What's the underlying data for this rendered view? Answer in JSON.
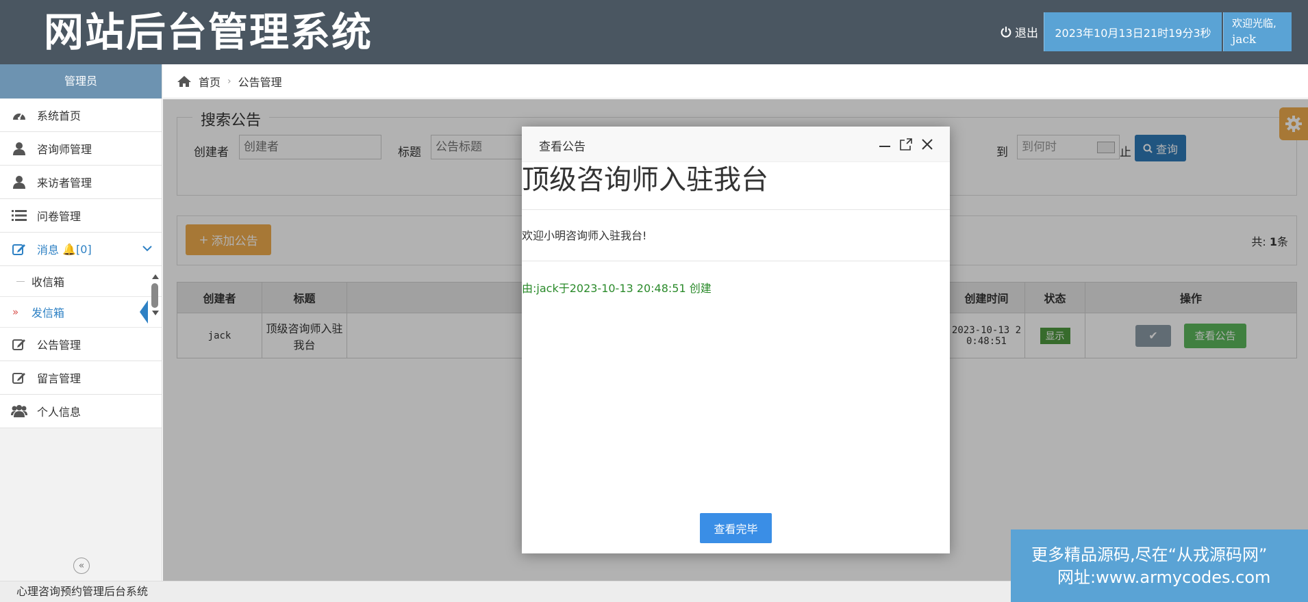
{
  "header": {
    "logo": "网站后台管理系统",
    "logout_label": "退出",
    "datetime": "2023年10月13日21时19分3秒",
    "welcome_label": "欢迎光临,",
    "username": "jack"
  },
  "sidebar": {
    "role": "管理员",
    "items": [
      {
        "label": "系统首页",
        "icon": "dashboard-icon"
      },
      {
        "label": "咨询师管理",
        "icon": "user-icon"
      },
      {
        "label": "来访者管理",
        "icon": "user-icon"
      },
      {
        "label": "问卷管理",
        "icon": "list-icon"
      }
    ],
    "messages": {
      "label": "消息",
      "bell": "🔔",
      "count": "[0]"
    },
    "submenu": [
      {
        "label": "收信箱"
      },
      {
        "label": "发信箱",
        "arrow": "»"
      }
    ],
    "items_after": [
      {
        "label": "公告管理",
        "icon": "edit-icon"
      },
      {
        "label": "留言管理",
        "icon": "edit-icon"
      },
      {
        "label": "个人信息",
        "icon": "users-icon"
      }
    ],
    "collapse_symbol": "«"
  },
  "breadcrumb": {
    "home": "首页",
    "separator": "›",
    "current": "公告管理"
  },
  "search": {
    "legend": "搜索公告",
    "creator_label": "创建者",
    "creator_placeholder": "创建者",
    "title_label": "标题",
    "title_placeholder": "公告标题",
    "to_label": "到",
    "end_placeholder": "到何时",
    "stop_label": "止",
    "query_label": "查询"
  },
  "toolbar": {
    "add_label": "添加公告",
    "add_symbol": "+",
    "total_prefix": "共:",
    "total_count": "1",
    "total_suffix": "条"
  },
  "table": {
    "headers": [
      "创建者",
      "标题",
      "创建时间",
      "状态",
      "操作"
    ],
    "rows": [
      {
        "creator": "jack",
        "title": "顶级咨询师入驻我台",
        "created_line1": "2023-10-13 2",
        "created_line2": "0:48:51",
        "status": "显示",
        "check_symbol": "✔",
        "view_label": "查看公告"
      }
    ]
  },
  "modal": {
    "title": "查看公告",
    "minimize": "—",
    "close": "✕",
    "heading": "顶级咨询师入驻我台",
    "body": "欢迎小明咨询师入驻我台!",
    "meta": "由:jack于2023-10-13 20:48:51 创建",
    "done_label": "查看完毕"
  },
  "footer": {
    "text": "心理咨询预约管理后台系统"
  },
  "promo": {
    "line1": "更多精品源码,尽在“从戎源码网”",
    "line2": "网址:www.armycodes.com"
  },
  "colors": {
    "header_bg": "#4a5661",
    "accent_blue": "#5aa3d5",
    "active": "#2e81c4",
    "warning": "#f0ad4e",
    "success": "#5cb85c"
  }
}
